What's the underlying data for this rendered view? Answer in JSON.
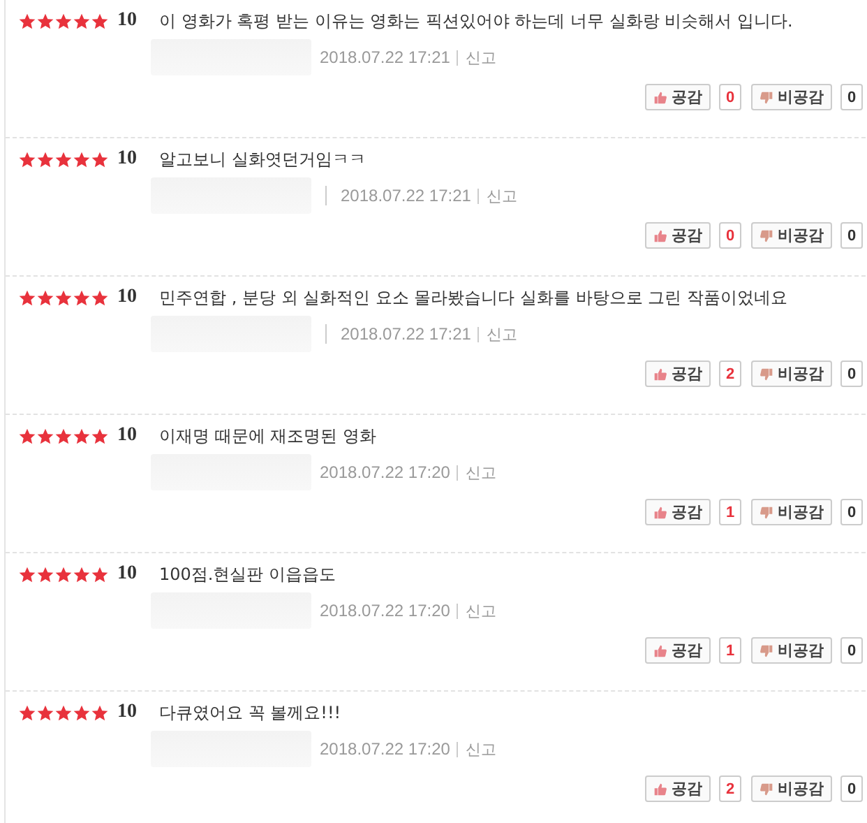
{
  "reviews": [
    {
      "stars": 5,
      "score": "10",
      "text": "이 영화가 혹평 받는 이유는 영화는 픽션있어야 하는데 너무 실화랑 비슷해서 입니다.",
      "lead_divider": false,
      "date": "2018.07.22 17:21",
      "report": "신고",
      "like_label": "공감",
      "likes": "0",
      "dislike_label": "비공감",
      "dislikes": "0"
    },
    {
      "stars": 5,
      "score": "10",
      "text": "알고보니 실화엿던거임ㅋㅋ",
      "lead_divider": true,
      "date": "2018.07.22 17:21",
      "report": "신고",
      "like_label": "공감",
      "likes": "0",
      "dislike_label": "비공감",
      "dislikes": "0"
    },
    {
      "stars": 5,
      "score": "10",
      "text": "민주연합 , 분당 외 실화적인 요소 몰라봤습니다 실화를 바탕으로 그린 작품이었네요",
      "lead_divider": true,
      "date": "2018.07.22 17:21",
      "report": "신고",
      "like_label": "공감",
      "likes": "2",
      "dislike_label": "비공감",
      "dislikes": "0"
    },
    {
      "stars": 5,
      "score": "10",
      "text": "이재명 때문에 재조명된 영화",
      "lead_divider": false,
      "date": "2018.07.22 17:20",
      "report": "신고",
      "like_label": "공감",
      "likes": "1",
      "dislike_label": "비공감",
      "dislikes": "0"
    },
    {
      "stars": 5,
      "score": "10",
      "text": "100점.현실판 이읍읍도",
      "lead_divider": false,
      "date": "2018.07.22 17:20",
      "report": "신고",
      "like_label": "공감",
      "likes": "1",
      "dislike_label": "비공감",
      "dislikes": "0"
    },
    {
      "stars": 5,
      "score": "10",
      "text": "다큐였어요 꼭 볼께요!!!",
      "lead_divider": false,
      "date": "2018.07.22 17:20",
      "report": "신고",
      "like_label": "공감",
      "likes": "2",
      "dislike_label": "비공감",
      "dislikes": "0"
    }
  ]
}
